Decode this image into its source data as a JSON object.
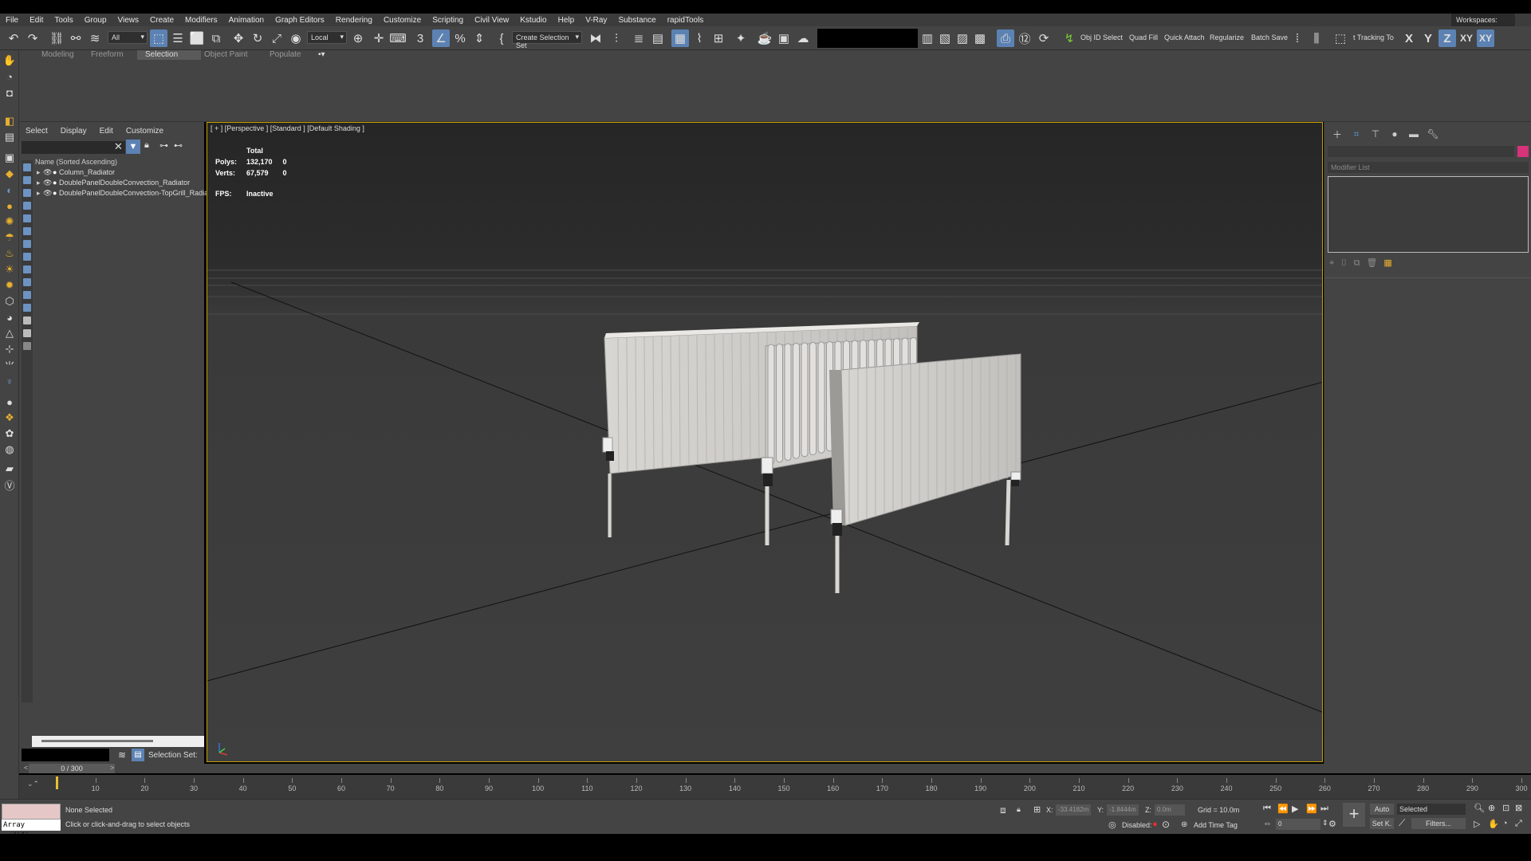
{
  "menu": [
    "File",
    "Edit",
    "Tools",
    "Group",
    "Views",
    "Create",
    "Modifiers",
    "Animation",
    "Graph Editors",
    "Rendering",
    "Customize",
    "Scripting",
    "Civil View",
    "Kstudio",
    "Help",
    "V-Ray",
    "Substance",
    "rapidTools"
  ],
  "workspaces_label": "Workspaces:",
  "toolbar": {
    "filter_value": "All",
    "coord_value": "Local",
    "named_selection": "Create Selection Set",
    "obj_id_select": "Obj ID Select",
    "quad_fill": "Quad Fill",
    "quick_attach": "Quick Attach",
    "regularize": "Regularize",
    "batch_save": "Batch Save",
    "tracking": "t Tracking To",
    "axis_x": "X",
    "axis_y": "Y",
    "axis_z": "Z",
    "axis_xy": "XY",
    "axis_xy2": "XY"
  },
  "ribbon_tabs": [
    "Modeling",
    "Freeform",
    "Selection",
    "Object Paint",
    "Populate"
  ],
  "ribbon_active_tab": "Selection",
  "explorer": {
    "menu": [
      "Select",
      "Display",
      "Edit",
      "Customize"
    ],
    "column_header": "Name (Sorted Ascending)",
    "rows": [
      "Column_Radiator",
      "DoublePanelDoubleConvection_Radiator",
      "DoublePanelDoubleConvection-TopGrill_Radiator"
    ],
    "selection_set_label": "Selection Set:"
  },
  "viewport": {
    "label": "[ + ] [Perspective ] [Standard ] [Default Shading ]",
    "stats": {
      "total_label": "Total",
      "polys_label": "Polys:",
      "polys_total": "132,170",
      "polys_sel": "0",
      "verts_label": "Verts:",
      "verts_total": "67,579",
      "verts_sel": "0",
      "fps_label": "FPS:",
      "fps_value": "Inactive"
    }
  },
  "command_panel": {
    "modifier_list": "Modifier List",
    "accent_color": "#d6337a"
  },
  "timeline": {
    "frame_display": "0 / 300",
    "ticks": [
      10,
      20,
      30,
      40,
      50,
      60,
      70,
      80,
      90,
      100,
      110,
      120,
      130,
      140,
      150,
      160,
      170,
      180,
      190,
      200,
      210,
      220,
      230,
      240,
      250,
      260,
      270,
      280,
      290,
      300
    ]
  },
  "status": {
    "maxscript_text": "Array modifier",
    "selected_text": "None Selected",
    "prompt_text": "Click or click-and-drag to select objects",
    "x_label": "X:",
    "x_value": "-33.4182m",
    "y_label": "Y:",
    "y_value": "-1.8444m",
    "z_label": "Z:",
    "z_value": "0.0m",
    "grid_text": "Grid = 10.0m",
    "disabled_label": "Disabled:",
    "add_time_tag": "Add Time Tag",
    "auto_label": "Auto",
    "selected_dropdown": "Selected",
    "setk_label": "Set K.",
    "filters_label": "Filters...",
    "frame_value": "0"
  }
}
